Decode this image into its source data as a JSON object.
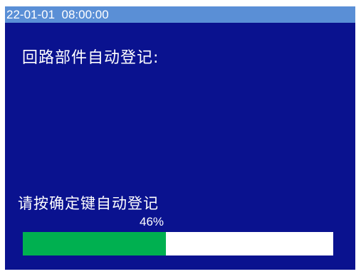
{
  "header": {
    "datetime": "22-01-01  08:00:00"
  },
  "main": {
    "heading": "回路部件自动登记:",
    "instruction": "请按确定键自动登记",
    "progress": {
      "percent_label": "46%",
      "fraction": 0.46
    }
  },
  "colors": {
    "background": "#0a128f",
    "titlebar": "#5a8fd6",
    "progress_fill": "#00b050",
    "progress_track": "#ffffff",
    "text": "#ffffff"
  }
}
